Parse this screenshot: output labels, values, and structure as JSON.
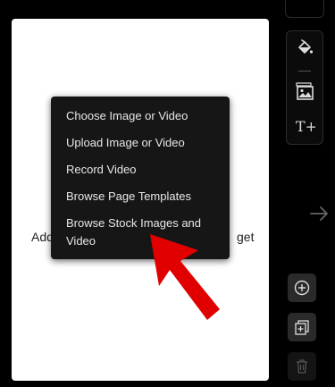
{
  "card": {
    "text_left": "Add",
    "text_right": "get"
  },
  "menu": {
    "items": [
      {
        "label": "Choose Image or Video"
      },
      {
        "label": "Upload Image or Video"
      },
      {
        "label": "Record Video"
      },
      {
        "label": "Browse Page Templates"
      },
      {
        "label": "Browse Stock Images and Video"
      }
    ]
  },
  "toolbar": {
    "icons": [
      "paint-bucket-icon",
      "image-gallery-icon",
      "add-text-icon"
    ],
    "add_text_glyph": "T+"
  },
  "actions": {
    "icons": [
      "add-page-icon",
      "duplicate-page-icon",
      "delete-page-icon"
    ]
  },
  "colors": {
    "background": "#000000",
    "card": "#ffffff",
    "menu": "#161616",
    "annotation_arrow": "#e00000"
  }
}
